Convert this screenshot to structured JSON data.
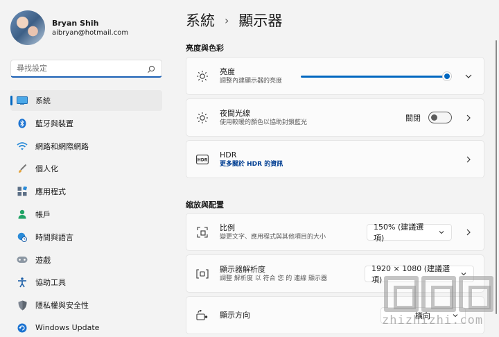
{
  "profile": {
    "name": "Bryan Shih",
    "email": "aibryan@hotmail.com"
  },
  "search": {
    "placeholder": "尋找設定"
  },
  "nav": {
    "items": [
      {
        "label": "系統",
        "icon": "display-icon",
        "active": true
      },
      {
        "label": "藍牙與裝置",
        "icon": "bluetooth-icon"
      },
      {
        "label": "網路和網際網路",
        "icon": "wifi-icon"
      },
      {
        "label": "個人化",
        "icon": "brush-icon"
      },
      {
        "label": "應用程式",
        "icon": "apps-icon"
      },
      {
        "label": "帳戶",
        "icon": "person-icon"
      },
      {
        "label": "時間與語言",
        "icon": "globe-clock-icon"
      },
      {
        "label": "遊戲",
        "icon": "gamepad-icon"
      },
      {
        "label": "協助工具",
        "icon": "accessibility-icon"
      },
      {
        "label": "隱私權與安全性",
        "icon": "shield-icon"
      },
      {
        "label": "Windows Update",
        "icon": "update-icon"
      }
    ]
  },
  "breadcrumb": {
    "parent": "系統",
    "separator": "›",
    "current": "顯示器"
  },
  "sections": {
    "brightness_color": "亮度與色彩",
    "scale_layout": "縮放與配置"
  },
  "cards": {
    "brightness": {
      "title": "亮度",
      "desc": "調整內建顯示器的亮度",
      "value": 1.0
    },
    "night_light": {
      "title": "夜間光線",
      "desc": "使用較暖的顏色以協助封鎖藍光",
      "toggle_label": "關閉"
    },
    "hdr": {
      "title": "HDR",
      "link": "更多關於 HDR 的資訊"
    },
    "scale": {
      "title": "比例",
      "desc": "變更文字、應用程式與其他項目的大小",
      "value": "150% (建議選項)"
    },
    "resolution": {
      "title": "顯示器解析度",
      "desc": "調整 解析度 以 符合 您 的 連線 顯示器",
      "value": "1920 × 1080 (建議選項)"
    },
    "orientation": {
      "title": "顯示方向",
      "value": "橫向"
    }
  },
  "watermark": {
    "text": "zhizhizhi.com"
  },
  "colors": {
    "accent": "#0067c0",
    "link": "#003e92",
    "background": "#f3f3f3",
    "card": "#fbfbfb"
  }
}
